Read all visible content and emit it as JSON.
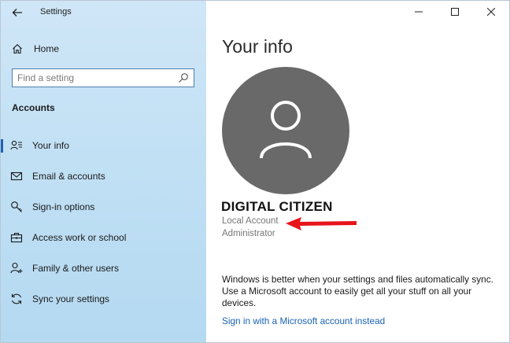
{
  "window": {
    "title": "Settings"
  },
  "sidebar": {
    "home_label": "Home",
    "search_placeholder": "Find a setting",
    "section_title": "Accounts",
    "items": [
      {
        "label": "Your info",
        "icon": "person-list-icon",
        "selected": true
      },
      {
        "label": "Email & accounts",
        "icon": "mail-icon"
      },
      {
        "label": "Sign-in options",
        "icon": "key-icon"
      },
      {
        "label": "Access work or school",
        "icon": "briefcase-icon"
      },
      {
        "label": "Family & other users",
        "icon": "person-add-icon"
      },
      {
        "label": "Sync your settings",
        "icon": "sync-icon"
      }
    ]
  },
  "main": {
    "title": "Your info",
    "user": {
      "name": "DIGITAL CITIZEN",
      "account_type": "Local Account",
      "role": "Administrator"
    },
    "sync_text": "Windows is better when your settings and files automatically sync. Use a Microsoft account to easily get all your stuff on all your devices.",
    "link_label": "Sign in with a Microsoft account instead"
  },
  "colors": {
    "accent": "#1b63b4",
    "annotation_arrow": "#e8141b",
    "avatar_bg": "#696969"
  }
}
